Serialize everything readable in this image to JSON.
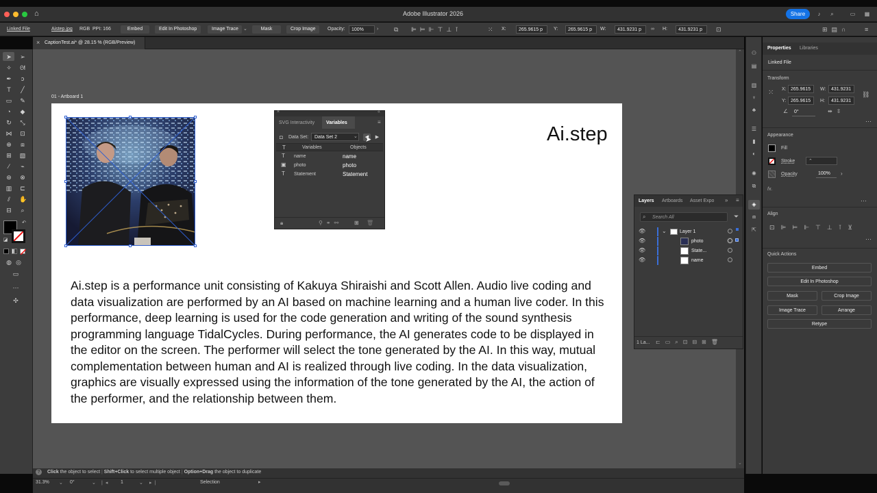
{
  "window": {
    "title": "Adobe Illustrator 2026",
    "share_label": "Share"
  },
  "control_bar": {
    "object_type": "Linked File",
    "file_name": "Aistep.jpg",
    "color_mode": "RGB",
    "ppi": "PPI: 166",
    "embed": "Embed",
    "edit_in_photoshop": "Edit In Photoshop",
    "image_trace": "Image Trace",
    "mask": "Mask",
    "crop_image": "Crop Image",
    "opacity_label": "Opacity:",
    "opacity_value": "100%",
    "x_label": "X:",
    "x_value": "265.9615 p",
    "y_label": "Y:",
    "y_value": "265.9615 p",
    "w_label": "W:",
    "w_value": "431.9231 p",
    "h_label": "H:",
    "h_value": "431.9231 p"
  },
  "document_tab": {
    "label": "CaptionTest.ai* @ 28.15 % (RGB/Preview)"
  },
  "artboard": {
    "label": "01 - Artboard 1",
    "heading": "Ai.step",
    "body": "Ai.step is a performance unit consisting of Kakuya Shiraishi and Scott Allen. Audio live coding and data visualization are performed by an AI based on machine learning and a human live coder. In this performance, deep learning is used for the code generation and writing of the sound synthesis programming language TidalCycles. During performance, the AI generates code to be displayed in the editor on the screen. The performer will select the tone generated by the AI. In this way, mutual complementation between human and AI is realized through live coding. In the data visualization, graphics are visually expressed using the information of the tone generated by the AI, the action of the performer, and the relationship between them."
  },
  "variables_panel": {
    "tab_svg": "SVG Interactivity",
    "tab_variables": "Variables",
    "dataset_label": "Data Set:",
    "dataset_value": "Data Set 2",
    "col_variables": "Variables",
    "col_objects": "Objects",
    "rows": [
      {
        "type": "T",
        "variable": "name",
        "object": "name"
      },
      {
        "type": "img",
        "variable": "photo",
        "object": "photo"
      },
      {
        "type": "T",
        "variable": "Statement",
        "object": "Statement"
      }
    ]
  },
  "layers_panel": {
    "tabs": [
      "Layers",
      "Artboards",
      "Asset Expo"
    ],
    "search_placeholder": "Search All",
    "layer_name": "Layer 1",
    "items": [
      "photo",
      "State...",
      "name"
    ],
    "footer_count": "1 La..."
  },
  "properties_panel": {
    "tab_properties": "Properties",
    "tab_libraries": "Libraries",
    "object_type": "Linked File",
    "transform_title": "Transform",
    "x_label": "X:",
    "x_value": "265.9615",
    "y_label": "Y:",
    "y_value": "265.9615",
    "w_label": "W:",
    "w_value": "431.9231",
    "h_label": "H:",
    "h_value": "431.9231",
    "rotation_value": "0°",
    "appearance_title": "Appearance",
    "fill_label": "Fill",
    "stroke_label": "Stroke",
    "opacity_label": "Opacity",
    "opacity_value": "100%",
    "fx_label": "fx.",
    "align_title": "Align",
    "quick_actions_title": "Quick Actions",
    "quick_actions": {
      "embed": "Embed",
      "edit_in_photoshop": "Edit In Photoshop",
      "mask": "Mask",
      "crop_image": "Crop Image",
      "image_trace": "Image Trace",
      "arrange": "Arrange",
      "retype": "Retype"
    }
  },
  "status_bar": {
    "hint_click": "Click",
    "hint_click_text": " the object to select",
    "hint_shift": "Shift+Click",
    "hint_shift_text": " to select multiple object",
    "hint_option": "Option+Drag",
    "hint_option_text": " the object to duplicate",
    "zoom": "31.3%",
    "rotation": "0°",
    "artboard_num": "1",
    "tool": "Selection"
  },
  "colors": {
    "accent": "#1473e6",
    "selection": "#2f5fd0",
    "canvas": "#545454"
  }
}
